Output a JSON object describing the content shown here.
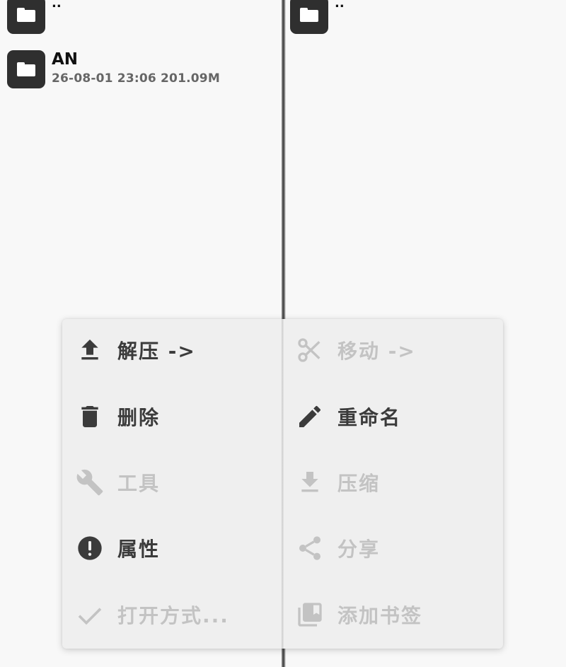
{
  "left_pane": {
    "entries": [
      {
        "name": "..",
        "meta": ""
      },
      {
        "name": "AN",
        "meta": "26-08-01 23:06  201.09M"
      }
    ]
  },
  "right_pane": {
    "entries": [
      {
        "name": "..",
        "meta": ""
      }
    ]
  },
  "context_menu": {
    "left_column": [
      {
        "label": "解压 ->",
        "icon": "upload-icon",
        "enabled": true
      },
      {
        "label": "删除",
        "icon": "trash-icon",
        "enabled": true
      },
      {
        "label": "工具",
        "icon": "wrench-icon",
        "enabled": false
      },
      {
        "label": "属性",
        "icon": "info-icon",
        "enabled": true
      },
      {
        "label": "打开方式...",
        "icon": "check-icon",
        "enabled": false
      }
    ],
    "right_column": [
      {
        "label": "移动 ->",
        "icon": "scissors-icon",
        "enabled": false
      },
      {
        "label": "重命名",
        "icon": "pencil-icon",
        "enabled": true
      },
      {
        "label": "压缩",
        "icon": "download-icon",
        "enabled": false
      },
      {
        "label": "分享",
        "icon": "share-icon",
        "enabled": false
      },
      {
        "label": "添加书签",
        "icon": "bookmarks-icon",
        "enabled": false
      }
    ]
  },
  "colors": {
    "enabled_text": "#3b3b3b",
    "disabled_text": "#c3c3c3",
    "folder_icon_bg": "#2f2f2f"
  }
}
